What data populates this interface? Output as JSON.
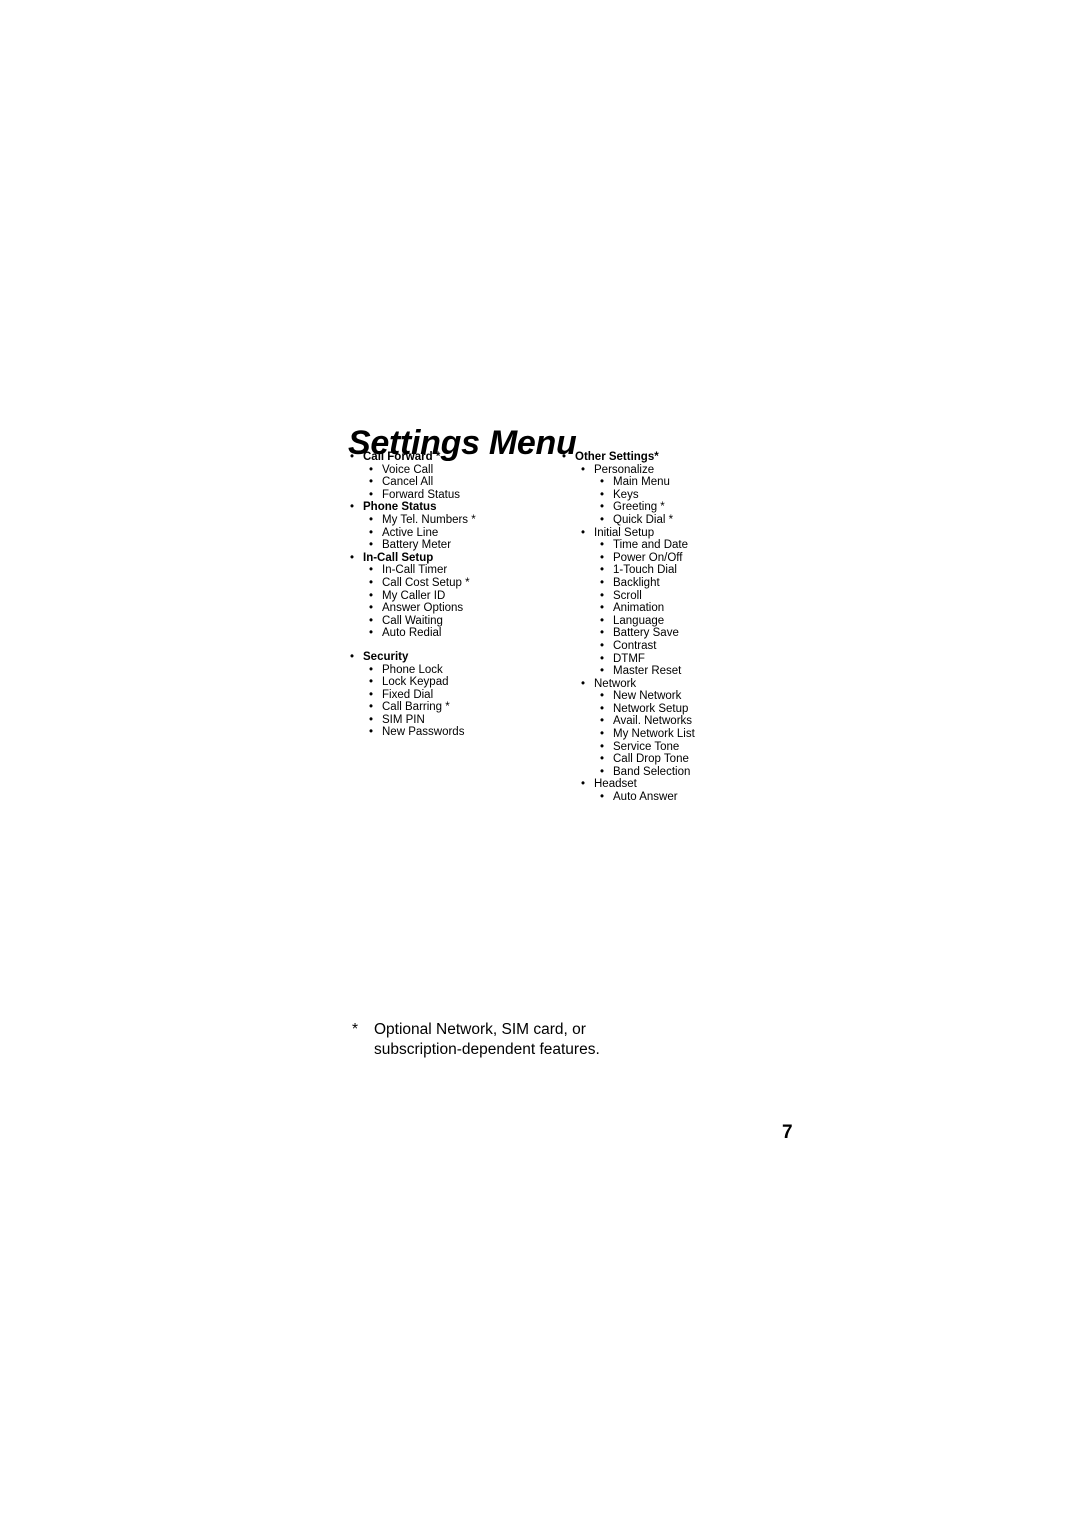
{
  "document": {
    "title": "Settings Menu",
    "page_number": "7"
  },
  "footnote": {
    "marker": "*",
    "text": "Optional Network, SIM card, or subscription-dependent features."
  },
  "menu": {
    "left_column": [
      {
        "label": "Call Forward *",
        "level": 1,
        "bold": true,
        "children": [
          {
            "label": "Voice Call",
            "level": 2,
            "bold": false
          },
          {
            "label": "Cancel All",
            "level": 2,
            "bold": false
          },
          {
            "label": "Forward Status",
            "level": 2,
            "bold": false
          }
        ]
      },
      {
        "label": "Phone Status",
        "level": 1,
        "bold": true,
        "children": [
          {
            "label": "My Tel. Numbers *",
            "level": 2,
            "bold": false
          },
          {
            "label": "Active Line",
            "level": 2,
            "bold": false
          },
          {
            "label": "Battery Meter",
            "level": 2,
            "bold": false
          }
        ]
      },
      {
        "label": "In-Call Setup",
        "level": 1,
        "bold": true,
        "children": [
          {
            "label": "In-Call Timer",
            "level": 2,
            "bold": false
          },
          {
            "label": "Call Cost Setup *",
            "level": 2,
            "bold": false
          },
          {
            "label": "My Caller ID",
            "level": 2,
            "bold": false
          },
          {
            "label": "Answer Options",
            "level": 2,
            "bold": false
          },
          {
            "label": "Call Waiting",
            "level": 2,
            "bold": false
          },
          {
            "label": "Auto Redial",
            "level": 2,
            "bold": false
          }
        ]
      },
      {
        "label": "Security",
        "level": 1,
        "bold": true,
        "gap_before": true,
        "children": [
          {
            "label": "Phone Lock",
            "level": 2,
            "bold": false
          },
          {
            "label": "Lock Keypad",
            "level": 2,
            "bold": false
          },
          {
            "label": "Fixed Dial",
            "level": 2,
            "bold": false
          },
          {
            "label": "Call Barring *",
            "level": 2,
            "bold": false
          },
          {
            "label": "SIM PIN",
            "level": 2,
            "bold": false
          },
          {
            "label": "New Passwords",
            "level": 2,
            "bold": false
          }
        ]
      }
    ],
    "right_column": [
      {
        "label": "Other Settings*",
        "level": 1,
        "bold": true,
        "children": [
          {
            "label": "Personalize",
            "level": 2,
            "bold": false,
            "children": [
              {
                "label": "Main Menu",
                "level": 3,
                "bold": false
              },
              {
                "label": "Keys",
                "level": 3,
                "bold": false
              },
              {
                "label": "Greeting *",
                "level": 3,
                "bold": false
              },
              {
                "label": "Quick Dial *",
                "level": 3,
                "bold": false
              }
            ]
          },
          {
            "label": "Initial Setup",
            "level": 2,
            "bold": false,
            "children": [
              {
                "label": "Time and Date",
                "level": 3,
                "bold": false
              },
              {
                "label": "Power On/Off",
                "level": 3,
                "bold": false
              },
              {
                "label": "1-Touch Dial",
                "level": 3,
                "bold": false
              },
              {
                "label": "Backlight",
                "level": 3,
                "bold": false
              },
              {
                "label": "Scroll",
                "level": 3,
                "bold": false
              },
              {
                "label": "Animation",
                "level": 3,
                "bold": false
              },
              {
                "label": "Language",
                "level": 3,
                "bold": false
              },
              {
                "label": "Battery Save",
                "level": 3,
                "bold": false
              },
              {
                "label": "Contrast",
                "level": 3,
                "bold": false
              },
              {
                "label": "DTMF",
                "level": 3,
                "bold": false
              },
              {
                "label": "Master Reset",
                "level": 3,
                "bold": false
              }
            ]
          },
          {
            "label": "Network",
            "level": 2,
            "bold": false,
            "children": [
              {
                "label": "New Network",
                "level": 3,
                "bold": false
              },
              {
                "label": "Network Setup",
                "level": 3,
                "bold": false
              },
              {
                "label": "Avail. Networks",
                "level": 3,
                "bold": false
              },
              {
                "label": "My Network List",
                "level": 3,
                "bold": false
              },
              {
                "label": "Service Tone",
                "level": 3,
                "bold": false
              },
              {
                "label": "Call Drop Tone",
                "level": 3,
                "bold": false
              },
              {
                "label": "Band Selection",
                "level": 3,
                "bold": false
              }
            ]
          },
          {
            "label": "Headset",
            "level": 2,
            "bold": false,
            "children": [
              {
                "label": "Auto Answer",
                "level": 3,
                "bold": false
              }
            ]
          }
        ]
      }
    ]
  },
  "icons": {
    "bullet": "•"
  }
}
